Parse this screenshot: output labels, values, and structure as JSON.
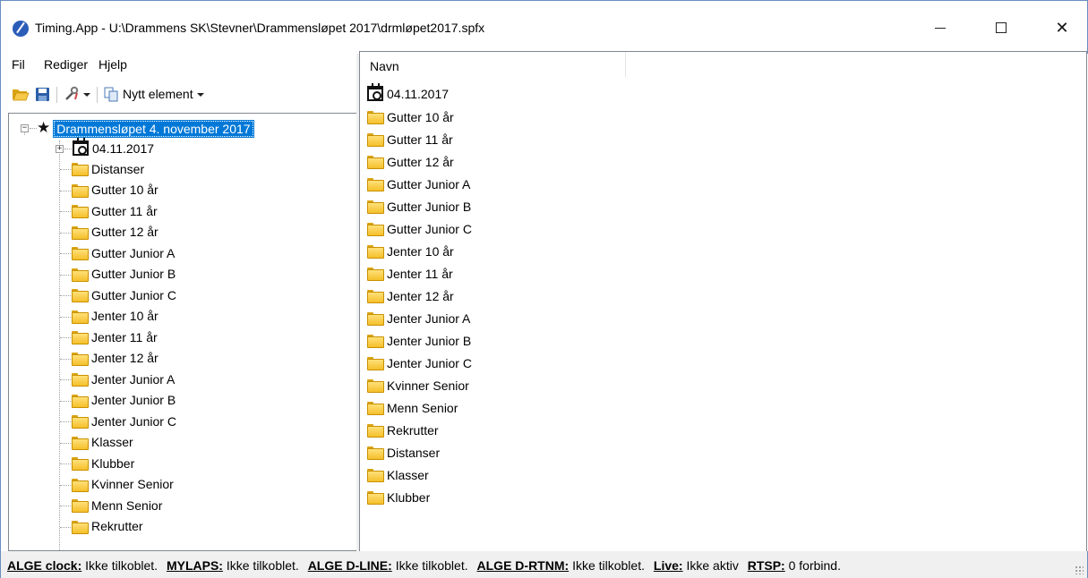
{
  "window": {
    "title": "Timing.App - U:\\Drammens SK\\Stevner\\Drammensløpet 2017\\drmløpet2017.spfx",
    "minimize_glyph": "—",
    "maximize_glyph": "☐",
    "close_glyph": "✕"
  },
  "menu": {
    "items": [
      "Fil",
      "Rediger",
      "Hjelp"
    ]
  },
  "toolbar": {
    "open_icon": "folder-open-icon",
    "save_icon": "save-icon",
    "tools_icon": "tools-icon",
    "new_element_label": "Nytt element"
  },
  "tree": {
    "root_label": "Drammensløpet 4. november 2017",
    "date_node": "04.11.2017",
    "children": [
      "Distanser",
      "Gutter 10 år",
      "Gutter 11 år",
      "Gutter 12 år",
      "Gutter Junior A",
      "Gutter Junior B",
      "Gutter Junior C",
      "Jenter 10 år",
      "Jenter 11 år",
      "Jenter 12 år",
      "Jenter Junior A",
      "Jenter Junior B",
      "Jenter Junior C",
      "Klasser",
      "Klubber",
      "Kvinner Senior",
      "Menn Senior",
      "Rekrutter"
    ]
  },
  "list": {
    "column_header": "Navn",
    "date_item": "04.11.2017",
    "items": [
      "Gutter 10 år",
      "Gutter 11 år",
      "Gutter 12 år",
      "Gutter Junior A",
      "Gutter Junior B",
      "Gutter Junior C",
      "Jenter 10 år",
      "Jenter 11 år",
      "Jenter 12 år",
      "Jenter Junior A",
      "Jenter Junior B",
      "Jenter Junior C",
      "Kvinner Senior",
      "Menn Senior",
      "Rekrutter",
      "Distanser",
      "Klasser",
      "Klubber"
    ]
  },
  "status": {
    "alge_clock_label": "ALGE clock:",
    "alge_clock_value": "Ikke tilkoblet.",
    "mylaps_label": "MYLAPS:",
    "mylaps_value": "Ikke tilkoblet.",
    "alge_dline_label": "ALGE D-LINE:",
    "alge_dline_value": "Ikke tilkoblet.",
    "alge_drtnm_label": "ALGE D-RTNM:",
    "alge_drtnm_value": "Ikke tilkoblet.",
    "live_label": "Live:",
    "live_value": "Ikke aktiv",
    "rtsp_label": "RTSP:",
    "rtsp_value": "0 forbind."
  },
  "colors": {
    "selection": "#0078d7",
    "folder": "#f5c02b",
    "window_border": "#6a8dbf"
  }
}
